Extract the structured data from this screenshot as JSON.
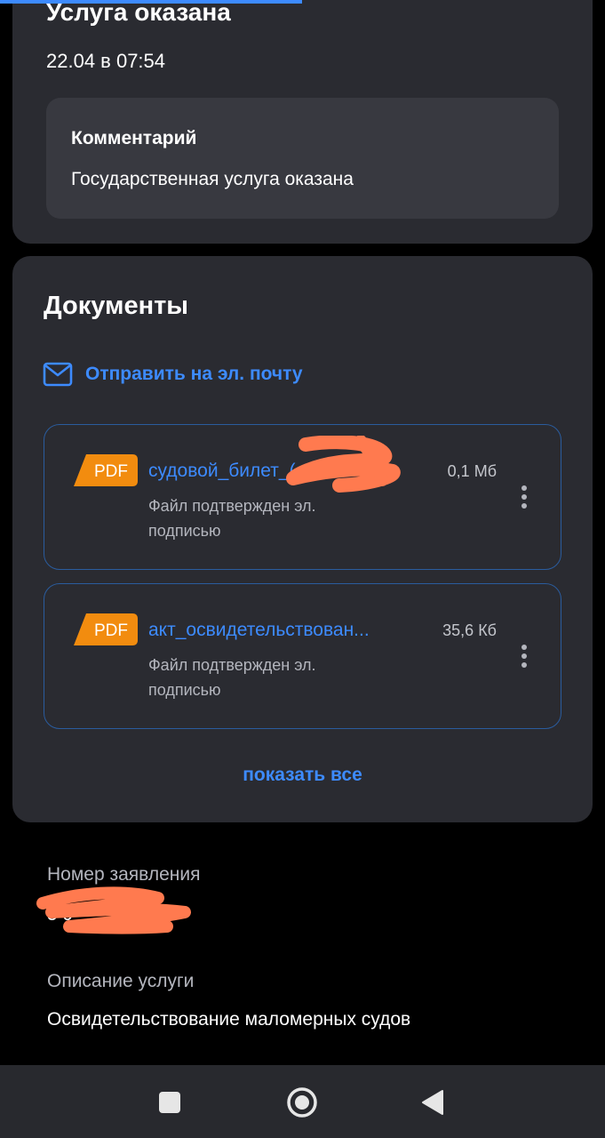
{
  "colors": {
    "background": "#000000",
    "card": "#2a2b31",
    "accent": "#3d8bff",
    "pdf_badge": "#f28c0f",
    "redaction": "#ff7a4f"
  },
  "status": {
    "title": "Услуга оказана",
    "date": "22.04 в 07:54",
    "comment_label": "Комментарий",
    "comment_text": "Государственная услуга оказана"
  },
  "documents": {
    "title": "Документы",
    "email_icon": "envelope-icon",
    "send_email_label": "Отправить на эл. почту",
    "items": [
      {
        "badge": "PDF",
        "name": "судовой_билет_(...",
        "size": "0,1 Мб",
        "signature": "Файл подтвержден эл. подписью",
        "menu_icon": "more-vertical-icon"
      },
      {
        "badge": "PDF",
        "name": "акт_освидетельствован...",
        "size": "35,6 Кб",
        "signature": "Файл подтвержден эл. подписью",
        "menu_icon": "more-vertical-icon"
      }
    ],
    "show_all_label": "показать все"
  },
  "application": {
    "number_label": "Номер заявления",
    "number_value": "5         9",
    "description_label": "Описание услуги",
    "description_value": "Освидетельствование маломерных судов"
  },
  "nav": {
    "recents_icon": "square-icon",
    "home_icon": "circle-home-icon",
    "back_icon": "triangle-back-icon"
  }
}
